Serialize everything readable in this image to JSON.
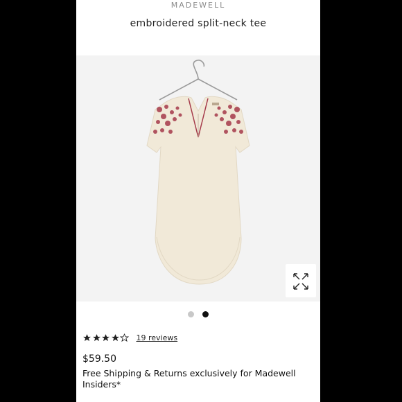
{
  "header": {
    "brand": "MADEWELL",
    "product_title": "embroidered split-neck tee"
  },
  "gallery": {
    "total_images": 2,
    "active_index": 1,
    "expand_icon": "expand-arrows-icon"
  },
  "rating": {
    "stars": 4,
    "max_stars": 5,
    "reviews_label": "19 reviews"
  },
  "price": "$59.50",
  "shipping_note": "Free Shipping & Returns exclusively for Madewell Insiders*",
  "colors": {
    "embroidery": "#a53a4a",
    "fabric": "#f1e9d8",
    "background": "#000000"
  }
}
